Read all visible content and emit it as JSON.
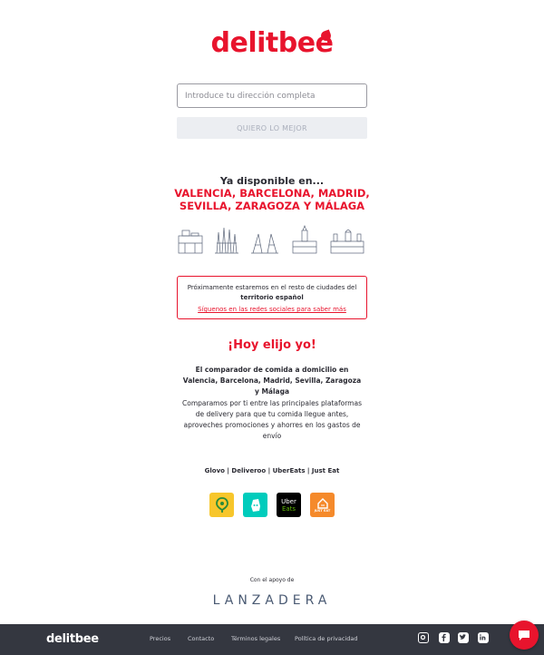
{
  "brand": {
    "name": "delitbee",
    "color": "#e8142d"
  },
  "search": {
    "placeholder": "Introduce tu dirección completa",
    "button_label": "QUIERO LO MEJOR"
  },
  "availability": {
    "title": "Ya disponible en...",
    "cities_line1": "VALENCIA, BARCELONA, MADRID,",
    "cities_line2": "SEVILLA, ZARAGOZA Y MÁLAGA",
    "skyline_icons": [
      "valencia-skyline-icon",
      "barcelona-skyline-icon",
      "madrid-skyline-icon",
      "sevilla-skyline-icon",
      "zaragoza-skyline-icon"
    ]
  },
  "coming_soon": {
    "line1": "Próximamente estaremos en el resto de ciudades del",
    "line2_bold": "territorio español",
    "link": "Síguenos en las redes sociales para saber más"
  },
  "claim": "¡Hoy elijo yo!",
  "description": {
    "bold": "El comparador de comida a domicilio en Valencia, Barcelona, Madrid, Sevilla, Zaragoza y Málaga",
    "body": "Comparamos por ti entre las principales plataformas de delivery para que tu comida llegue antes, aproveches promociones y ahorres en los gastos de envío"
  },
  "platforms": {
    "text": "Glovo | Deliveroo | UberEats | Just Eat",
    "apps": [
      {
        "name": "glovo-app-icon",
        "color": "#f7c62b"
      },
      {
        "name": "deliveroo-app-icon",
        "color": "#00ccbc"
      },
      {
        "name": "ubereats-app-icon",
        "color": "#000000",
        "label_top": "Uber",
        "label_bottom": "Eats"
      },
      {
        "name": "justeat-app-icon",
        "color": "#f58a2b",
        "label": "JUST EAT"
      }
    ]
  },
  "support": {
    "label": "Con el apoyo de",
    "partner": "LANZADERA"
  },
  "footer": {
    "logo": "delitbee",
    "links": [
      "Precios",
      "Contacto",
      "Términos legales",
      "Política de privacidad"
    ],
    "social_icons": [
      "instagram-icon",
      "facebook-icon",
      "twitter-icon",
      "linkedin-icon"
    ],
    "background": "#343740"
  },
  "chat": {
    "icon": "chat-bubble-icon"
  }
}
